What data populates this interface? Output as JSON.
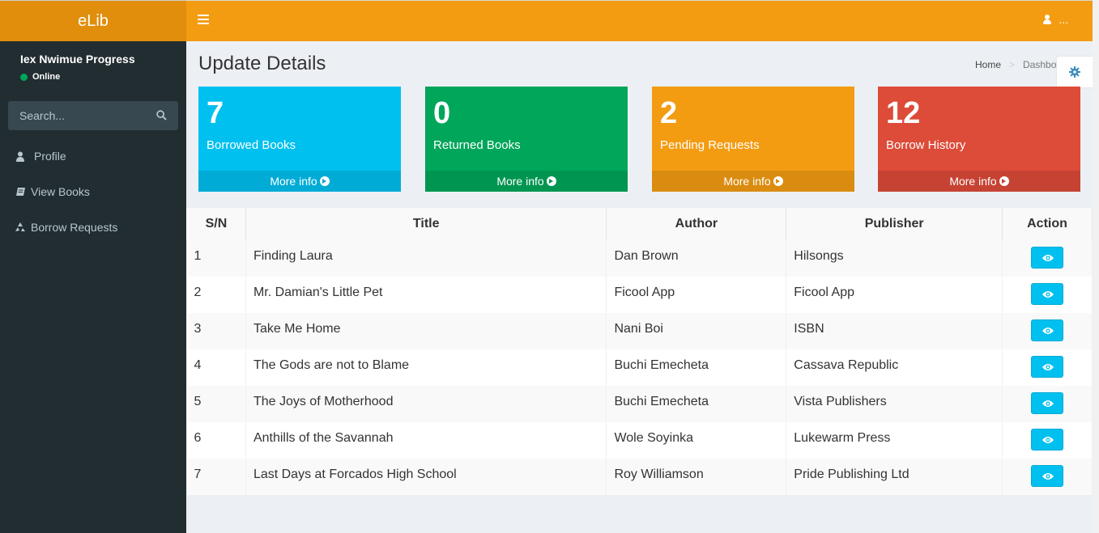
{
  "app": {
    "title": "eLib"
  },
  "user": {
    "name": "Iex Nwimue Progress",
    "status": "Online",
    "menu_label": "..."
  },
  "search": {
    "placeholder": "Search..."
  },
  "sidebar": {
    "items": [
      {
        "label": "Profile",
        "icon": "user-icon"
      },
      {
        "label": "View Books",
        "icon": "book-icon"
      },
      {
        "label": "Borrow Requests",
        "icon": "recycle-icon"
      }
    ]
  },
  "page": {
    "title": "Update Details"
  },
  "breadcrumb": {
    "home": "Home",
    "current": "Dashboard"
  },
  "stats": [
    {
      "value": "7",
      "label": "Borrowed Books",
      "more": "More info",
      "color": "#00c0ef"
    },
    {
      "value": "0",
      "label": "Returned Books",
      "more": "More info",
      "color": "#00a65a"
    },
    {
      "value": "2",
      "label": "Pending Requests",
      "more": "More info",
      "color": "#f39c12"
    },
    {
      "value": "12",
      "label": "Borrow History",
      "more": "More info",
      "color": "#dd4b39"
    }
  ],
  "table": {
    "headers": [
      "S/N",
      "Title",
      "Author",
      "Publisher",
      "Action"
    ],
    "rows": [
      {
        "sn": "1",
        "title": "Finding Laura",
        "author": "Dan Brown",
        "publisher": "Hilsongs"
      },
      {
        "sn": "2",
        "title": "Mr. Damian's Little Pet",
        "author": "Ficool App",
        "publisher": "Ficool App"
      },
      {
        "sn": "3",
        "title": "Take Me Home",
        "author": "Nani Boi",
        "publisher": "ISBN"
      },
      {
        "sn": "4",
        "title": "The Gods are not to Blame",
        "author": "Buchi Emecheta",
        "publisher": "Cassava Republic"
      },
      {
        "sn": "5",
        "title": "The Joys of Motherhood",
        "author": "Buchi Emecheta",
        "publisher": "Vista Publishers"
      },
      {
        "sn": "6",
        "title": "Anthills of the Savannah",
        "author": "Wole Soyinka",
        "publisher": "Lukewarm Press"
      },
      {
        "sn": "7",
        "title": "Last Days at Forcados High School",
        "author": "Roy Williamson",
        "publisher": "Pride Publishing Ltd"
      }
    ]
  },
  "colors": {
    "header": "#f39c12",
    "logo": "#e08e0b",
    "sidebar": "#222d32",
    "view_button": "#00c0ef"
  }
}
